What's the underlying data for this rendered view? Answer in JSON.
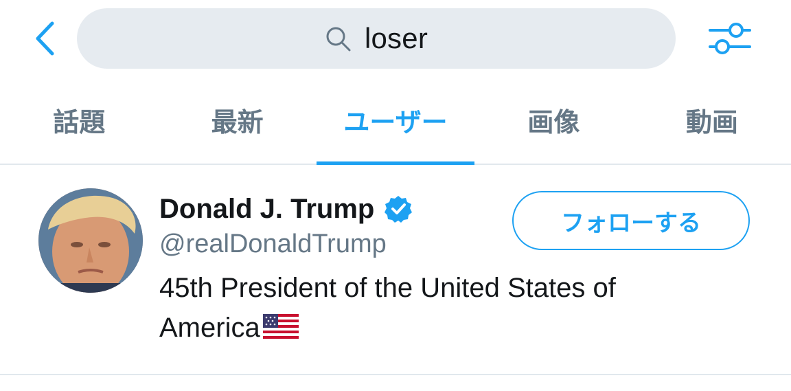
{
  "search": {
    "query": "loser",
    "icon": "search-icon"
  },
  "nav": {
    "back_icon": "chevron-left-icon",
    "filter_icon": "sliders-icon"
  },
  "tabs": [
    {
      "label": "話題",
      "active": false
    },
    {
      "label": "最新",
      "active": false
    },
    {
      "label": "ユーザー",
      "active": true
    },
    {
      "label": "画像",
      "active": false
    },
    {
      "label": "動画",
      "active": false
    }
  ],
  "results": [
    {
      "name": "Donald J. Trump",
      "verified": true,
      "handle": "@realDonaldTrump",
      "bio": "45th President of the United States of America",
      "bio_emoji": "us-flag",
      "follow_label": "フォローする"
    }
  ],
  "colors": {
    "accent": "#1da1f2",
    "text_primary": "#14171a",
    "text_secondary": "#657786",
    "search_bg": "#e6ebf0",
    "divider": "#e1e8ed"
  }
}
